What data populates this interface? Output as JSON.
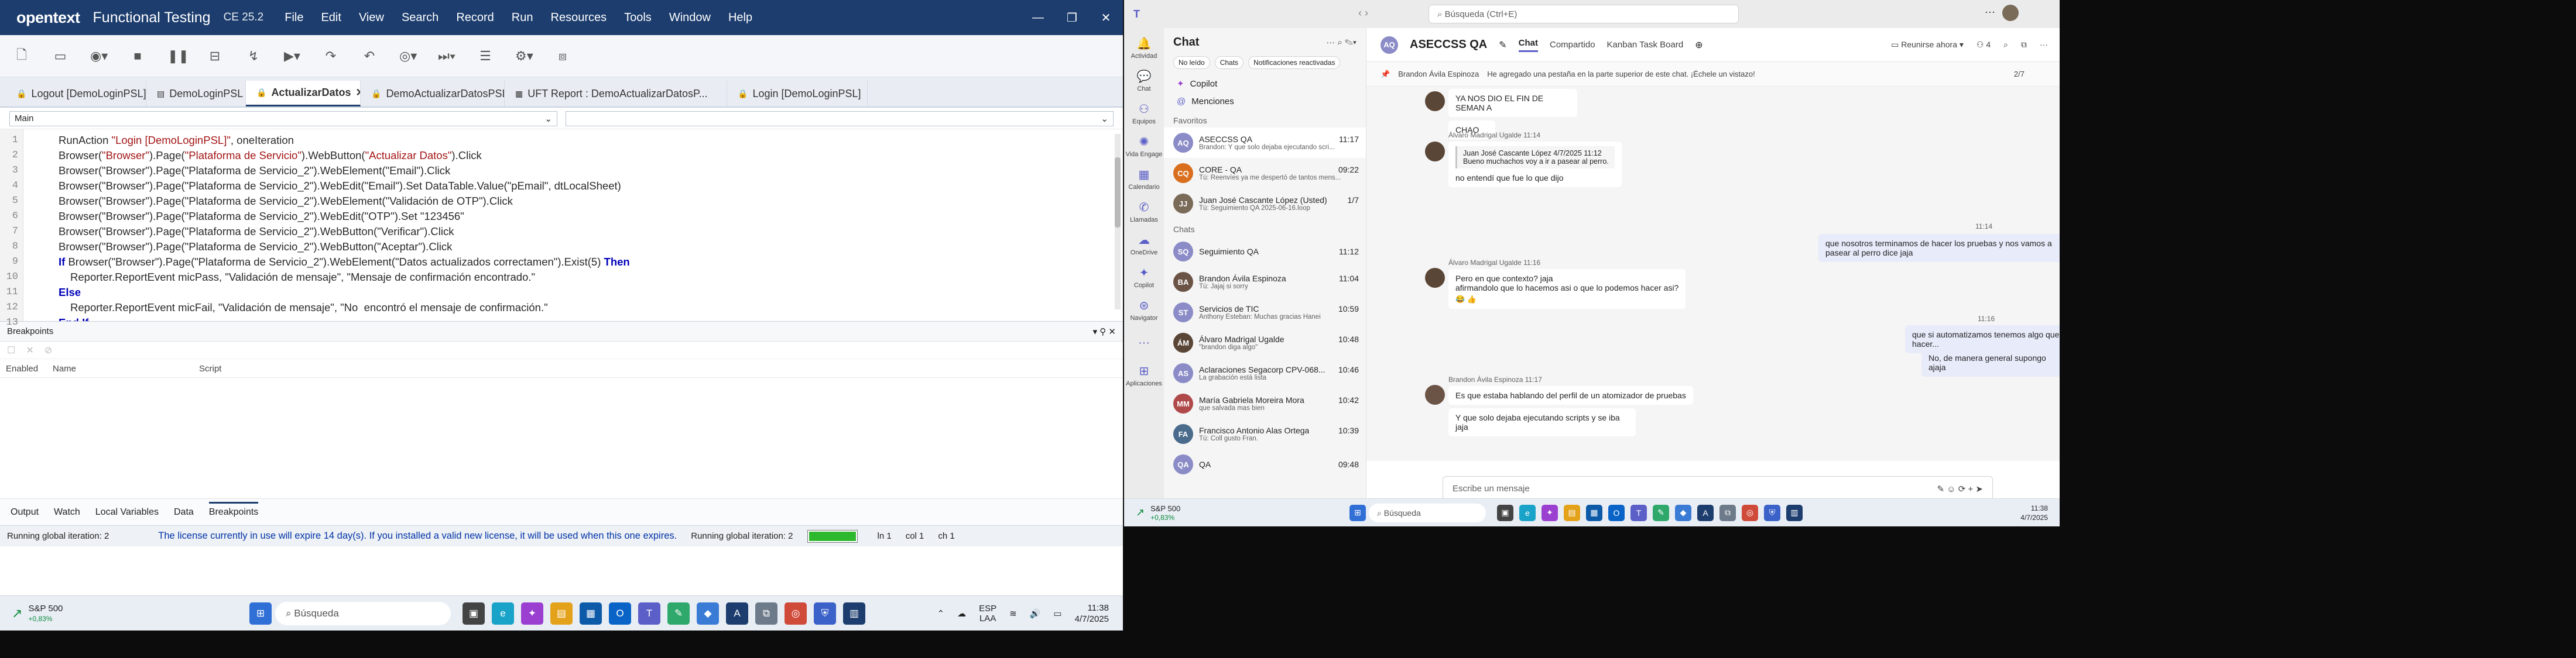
{
  "ft": {
    "logo": "opentext",
    "app_name": "Functional Testing",
    "version": "CE 25.2",
    "menu": [
      "File",
      "Edit",
      "View",
      "Search",
      "Record",
      "Run",
      "Resources",
      "Tools",
      "Window",
      "Help"
    ],
    "tabs": [
      {
        "label": "Logout [DemoLoginPSL]"
      },
      {
        "label": "DemoLoginPSL"
      },
      {
        "label": "ActualizarDatos"
      },
      {
        "label": "DemoActualizarDatosPSL"
      },
      {
        "label": "UFT Report : DemoActualizarDatosP..."
      },
      {
        "label": "Login [DemoLoginPSL]"
      }
    ],
    "combo_left": "Main",
    "combo_right": "",
    "line_numbers": [
      "1",
      "2",
      "3",
      "4",
      "5",
      "6",
      "7",
      "8",
      "9",
      "10",
      "11",
      "12",
      "13"
    ],
    "breakpoints_title": "Breakpoints",
    "bp_columns": [
      "Enabled",
      "Name",
      "Script"
    ],
    "bottom_tabs": [
      "Output",
      "Watch",
      "Local Variables",
      "Data",
      "Breakpoints"
    ],
    "status": {
      "left": "Running global iteration: 2",
      "license": "The license currently in use will expire 14 day(s). If you installed a valid new license, it will be used when this one expires.",
      "right": "Running global iteration: 2",
      "progress": 1.0,
      "ln": "ln 1",
      "col": "col 1",
      "ch": "ch 1"
    }
  },
  "code": {
    "l1a": "RunAction ",
    "l1b": "\"Login [DemoLoginPSL]\"",
    "l1c": ", oneIteration",
    "l2a": "Browser(",
    "l2b": "\"Browser\"",
    "l2c": ").Page(",
    "l2d": "\"Plataforma de Servicio\"",
    "l2e": ").WebButton(",
    "l2f": "\"Actualizar Datos\"",
    "l2g": ").Click",
    "l3": "Browser(\"Browser\").Page(\"Plataforma de Servicio_2\").WebElement(\"Email\").Click",
    "l4": "Browser(\"Browser\").Page(\"Plataforma de Servicio_2\").WebEdit(\"Email\").Set DataTable.Value(\"pEmail\", dtLocalSheet)",
    "l5": "Browser(\"Browser\").Page(\"Plataforma de Servicio_2\").WebElement(\"Validación de OTP\").Click",
    "l6": "Browser(\"Browser\").Page(\"Plataforma de Servicio_2\").WebEdit(\"OTP\").Set \"123456\"",
    "l7": "Browser(\"Browser\").Page(\"Plataforma de Servicio_2\").WebButton(\"Verificar\").Click",
    "l8": "Browser(\"Browser\").Page(\"Plataforma de Servicio_2\").WebButton(\"Aceptar\").Click",
    "l9a": "If ",
    "l9b": "Browser(\"Browser\").Page(\"Plataforma de Servicio_2\").WebElement(\"Datos actualizados correctamen\").Exist(5) ",
    "l9c": "Then",
    "l10": "Reporter.ReportEvent micPass, \"Validación de mensaje\", \"Mensaje de confirmación encontrado.\"",
    "l11": "Else",
    "l12": "Reporter.ReportEvent micFail, \"Validación de mensaje\", \"No  encontró el mensaje de confirmación.\"",
    "l13": "End If"
  },
  "teams": {
    "search_placeholder": "Búsqueda (Ctrl+E)",
    "rail": [
      "Actividad",
      "Chat",
      "Equipos",
      "Vida Engage",
      "Calendario",
      "Llamadas",
      "OneDrive",
      "Copilot",
      "Navigator",
      "",
      "Aplicaciones"
    ],
    "list_title": "Chat",
    "filters": [
      "No leído",
      "Chats",
      "Notificaciones reactivadas"
    ],
    "nav": [
      "Copilot",
      "Menciones"
    ],
    "favorites_label": "Favoritos",
    "favorites": [
      {
        "name": "ASECCSS QA",
        "time": "11:17",
        "preview": "Brandon: Y que solo dejaba ejecutando scri...",
        "color": "#8b8cc7",
        "initials": "AQ"
      },
      {
        "name": "CORE - QA",
        "time": "09:22",
        "preview": "Tú: Reenvíes ya me despertó de tantos mens...",
        "color": "#d96f1e",
        "initials": "CQ"
      },
      {
        "name": "Juan José Cascante López (Usted)",
        "time": "1/7",
        "preview": "Tú: Seguimiento QA 2025-06-16.loop",
        "color": "#7a6a58",
        "initials": "JJ"
      }
    ],
    "chats_label": "Chats",
    "chats": [
      {
        "name": "Seguimiento QA",
        "time": "11:12",
        "preview": "",
        "color": "#8b8cc7",
        "initials": "SQ"
      },
      {
        "name": "Brandon Ávila Espinoza",
        "time": "11:04",
        "preview": "Tú: Jajaj si sorry",
        "color": "#6b5446",
        "initials": "BA"
      },
      {
        "name": "Servicios de TIC",
        "time": "10:59",
        "preview": "Anthony Esteban: Muchas gracias Hanei",
        "color": "#8b8cc7",
        "initials": "ST"
      },
      {
        "name": "Álvaro Madrigal Ugalde",
        "time": "10:48",
        "preview": "\"brandon diga algo\"",
        "color": "#5a4636",
        "initials": "ÁM"
      },
      {
        "name": "Aclaraciones  Segacorp CPV-068...",
        "time": "10:46",
        "preview": "La grabación está lista",
        "color": "#8b8cc7",
        "initials": "AS"
      },
      {
        "name": "María Gabriela Moreira Mora",
        "time": "10:42",
        "preview": "que salvada mas bien",
        "color": "#b04a4a",
        "initials": "MM"
      },
      {
        "name": "Francisco Antonio Alas Ortega",
        "time": "10:39",
        "preview": "Tú: Coll gusto Fran.",
        "color": "#4a6b8b",
        "initials": "FA"
      },
      {
        "name": "QA",
        "time": "09:48",
        "preview": "",
        "color": "#8b8cc7",
        "initials": "QA"
      }
    ],
    "main_title": "ASECCSS QA",
    "main_tabs": [
      "Chat",
      "Compartido",
      "Kanban Task Board"
    ],
    "meet_now": "Reunirse ahora",
    "participants": "4",
    "pinned_author": "Brandon Ávila Espinoza",
    "pinned_text": "He agregado una pestaña en la parte superior de este chat. ¡Échele un vistazo!",
    "pinned_page": "2/7",
    "m1": "YA NOS DIO EL FIN DE SEMAN A",
    "m2": "CHAO",
    "m3_meta": "Álvaro Madrigal Ugalde  11:14",
    "m3_quote_author": "Juan José Cascante López  4/7/2025 11:12",
    "m3_quote": "Bueno muchachos voy a ir a pasear al perro.",
    "m3_text": "no entendí que fue lo que dijo",
    "t1": "11:14",
    "o1": "que nosotros terminamos de hacer los pruebas y nos vamos a pasear al perro dice jaja",
    "m4_meta": "Álvaro Madrigal Ugalde  11:16",
    "m4_l1": "Pero en que contexto? jaja",
    "m4_l2": "afirmandolo que lo hacemos asi o que lo podemos hacer asi?",
    "t2": "11:16",
    "o2": "que si automatizamos tenemos algo que hacer...",
    "o3": "No, de manera general supongo ajaja",
    "m5_meta": "Brandon Ávila Espinoza  11:17",
    "m5_l1": "Es que estaba hablando del perfil de un atomizador de pruebas",
    "m5_l2": "Y que solo dejaba ejecutando scripts y se iba jaja",
    "compose": "Escribe un mensaje",
    "weather_title": "S&P 500",
    "weather_value": "+0,83%",
    "search": "Búsqueda",
    "clock_time": "11:38",
    "clock_date": "4/7/2025"
  },
  "win": {
    "weather_title": "S&P 500",
    "weather_value": "+0,83%",
    "search": "Búsqueda",
    "lang1": "ESP",
    "lang2": "LAA",
    "time": "11:38",
    "date": "4/7/2025"
  }
}
